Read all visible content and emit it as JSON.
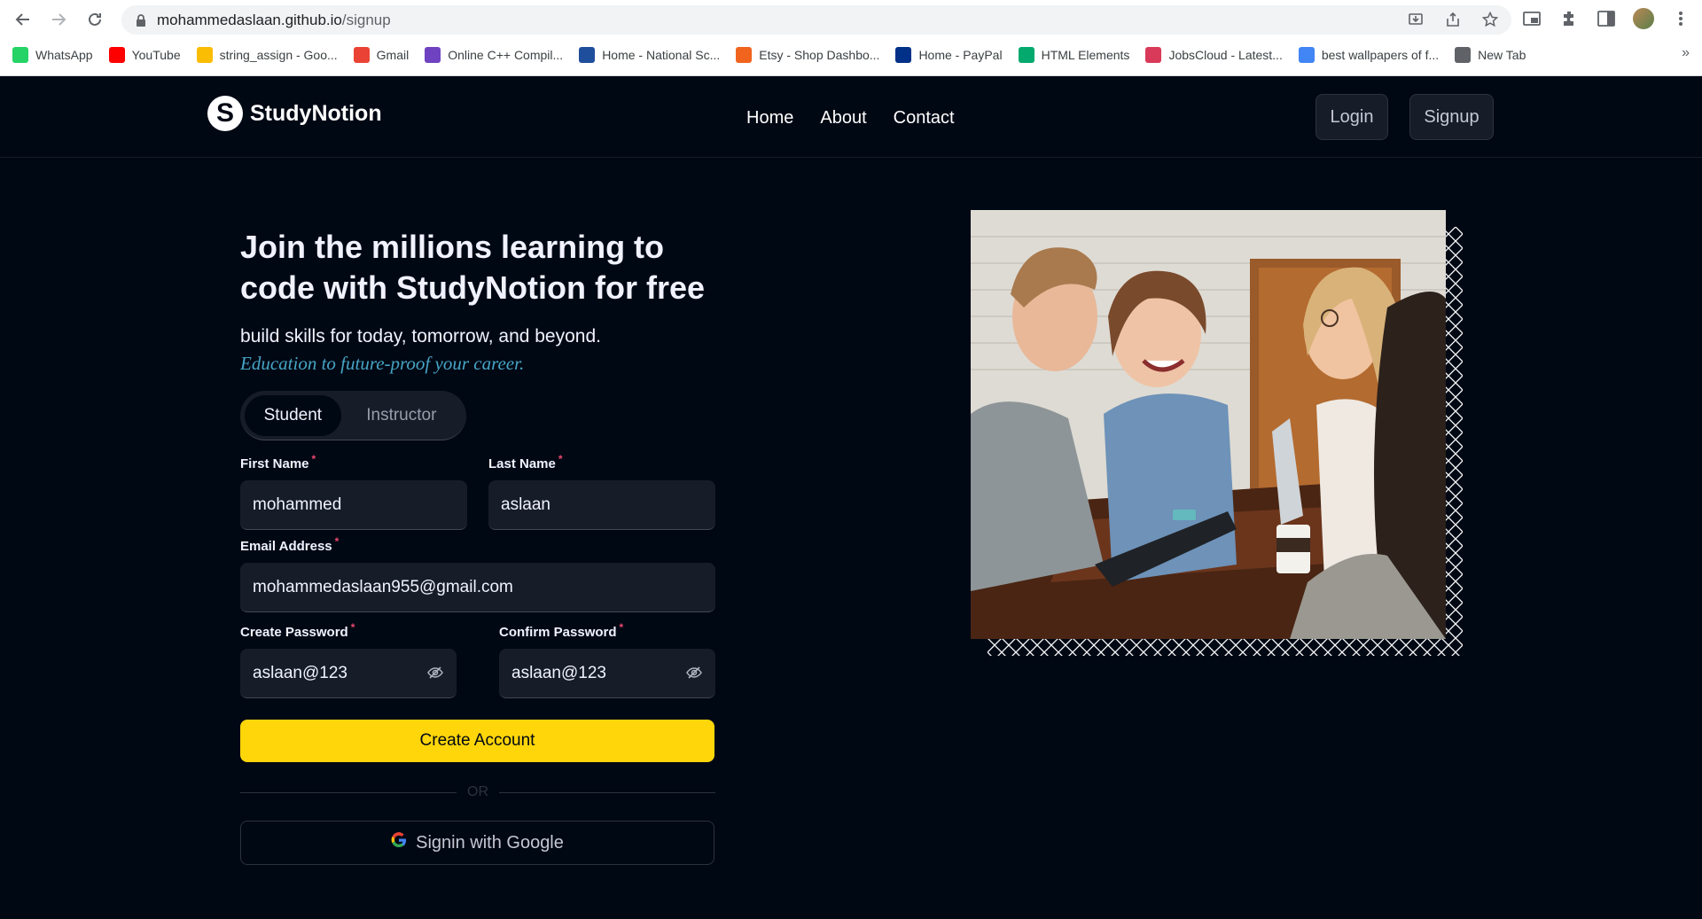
{
  "browser": {
    "url_host": "mohammedaslaan.github.io",
    "url_path": "/signup",
    "bookmarks": [
      {
        "label": "WhatsApp",
        "icon": "whatsapp-icon",
        "color": "#25d366"
      },
      {
        "label": "YouTube",
        "icon": "youtube-icon",
        "color": "#ff0000"
      },
      {
        "label": "string_assign - Goo...",
        "icon": "google-drive-icon",
        "color": "#fbbc04"
      },
      {
        "label": "Gmail",
        "icon": "gmail-icon",
        "color": "#ea4335"
      },
      {
        "label": "Online C++ Compil...",
        "icon": "lightning-icon",
        "color": "#6f42c1"
      },
      {
        "label": "Home - National Sc...",
        "icon": "nsc-icon",
        "color": "#1f4e9c"
      },
      {
        "label": "Etsy - Shop Dashbo...",
        "icon": "etsy-icon",
        "color": "#f1641e"
      },
      {
        "label": "Home - PayPal",
        "icon": "paypal-icon",
        "color": "#003087"
      },
      {
        "label": "HTML Elements",
        "icon": "w3-icon",
        "color": "#04aa6d"
      },
      {
        "label": "JobsCloud - Latest...",
        "icon": "jobscloud-icon",
        "color": "#d93a5a"
      },
      {
        "label": "best wallpapers of f...",
        "icon": "google-icon",
        "color": "#4285f4"
      },
      {
        "label": "New Tab",
        "icon": "globe-icon",
        "color": "#5f6368"
      }
    ],
    "more_bookmarks": "»"
  },
  "site": {
    "brand": "StudyNotion",
    "brand_letter": "S",
    "nav": [
      "Home",
      "About",
      "Contact"
    ],
    "login": "Login",
    "signup": "Signup"
  },
  "form": {
    "heading_line1": "Join the millions learning to",
    "heading_line2": "code with StudyNotion for free",
    "subtitle": "build skills for today, tomorrow, and beyond.",
    "tagline": "Education to future-proof your career.",
    "roles": [
      "Student",
      "Instructor"
    ],
    "active_role": "Student",
    "first_name_label": "First Name",
    "first_name_value": "mohammed",
    "last_name_label": "Last Name",
    "last_name_value": "aslaan",
    "email_label": "Email Address",
    "email_value": "mohammedaslaan955@gmail.com",
    "password_label": "Create Password",
    "password_value": "aslaan@123",
    "confirm_label": "Confirm Password",
    "confirm_value": "aslaan@123",
    "required_mark": "*",
    "create_button": "Create Account",
    "or_text": "OR",
    "google_button": "Signin with Google"
  },
  "colors": {
    "background": "#000814",
    "accent_yellow": "#ffd60a",
    "tagline_blue": "#47a5c5",
    "required_pink": "#ef476f",
    "input_bg": "#161d29"
  }
}
